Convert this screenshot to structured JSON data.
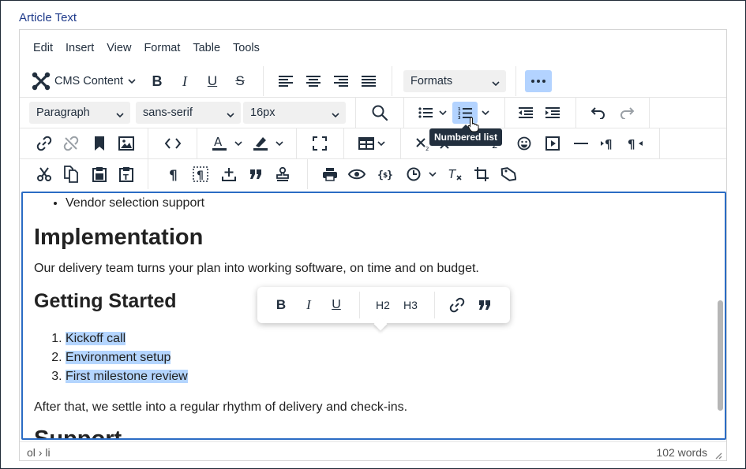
{
  "field_label": "Article Text",
  "menubar": [
    "Edit",
    "Insert",
    "View",
    "Format",
    "Table",
    "Tools"
  ],
  "toolbar": {
    "cms_content": "CMS Content",
    "formats": "Formats",
    "block_format": "Paragraph",
    "font_family": "sans-serif",
    "font_size": "16px",
    "bold": "B",
    "italic": "I",
    "underline": "U",
    "strike": "S"
  },
  "tooltip": "Numbered list",
  "content": {
    "bullet": "Vendor selection support",
    "h_implementation": "Implementation",
    "p_implementation": "Our delivery team turns your plan into working software, on time and on budget.",
    "h_getting_started": "Getting Started",
    "ol": [
      "Kickoff call",
      "Environment setup",
      "First milestone review"
    ],
    "p_after": "After that, we settle into a regular rhythm of delivery and check-ins.",
    "h_support": "Support"
  },
  "context_toolbar": {
    "bold": "B",
    "italic": "I",
    "underline": "U",
    "h2": "H2",
    "h3": "H3"
  },
  "statusbar": {
    "path": "ol › li",
    "words": "102 words"
  },
  "colors": {
    "accent": "#2b6cc4",
    "active": "#b3d3ff",
    "highlight": "#b4d5fe",
    "tooltip_bg": "#222f3e"
  }
}
